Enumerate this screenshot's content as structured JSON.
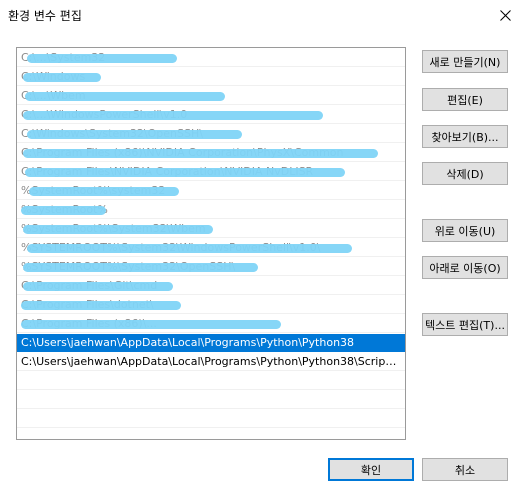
{
  "window": {
    "title": "환경 변수 편집"
  },
  "list": {
    "rows": [
      {
        "text": "C:\\...\\System32",
        "redacted": true
      },
      {
        "text": "C:\\Windows",
        "redacted": true
      },
      {
        "text": "C:\\...\\Wbem",
        "redacted": true
      },
      {
        "text": "C:\\...\\WindowsPowerShell\\v1.0",
        "redacted": true
      },
      {
        "text": "C:\\Windows\\System32\\OpenSSH\\",
        "redacted": true
      },
      {
        "text": "C:\\Program Files (x86)\\NVIDIA Corporation\\PhysX\\Common",
        "redacted": true
      },
      {
        "text": "C:\\Program Files\\NVIDIA Corporation\\NVIDIA NvDLISR",
        "redacted": true
      },
      {
        "text": "%SystemRoot%\\system32",
        "redacted": true
      },
      {
        "text": "%SystemRoot%",
        "redacted": true
      },
      {
        "text": "%SystemRoot%\\System32\\Wbem",
        "redacted": true
      },
      {
        "text": "%SYSTEMROOT%\\System32\\WindowsPowerShell\\v1.0\\",
        "redacted": true
      },
      {
        "text": "%SYSTEMROOT%\\System32\\OpenSSH\\",
        "redacted": true
      },
      {
        "text": "C:\\Program Files\\Git\\cmd",
        "redacted": true
      },
      {
        "text": "C:\\Program Files\\dotnet\\",
        "redacted": true
      },
      {
        "text": "C:\\Program Files (x86)\\...",
        "redacted": true
      },
      {
        "text": "C:\\Users\\jaehwan\\AppData\\Local\\Programs\\Python\\Python38",
        "redacted": false,
        "selected": true
      },
      {
        "text": "C:\\Users\\jaehwan\\AppData\\Local\\Programs\\Python\\Python38\\Scripts\\",
        "redacted": false,
        "selected": false
      }
    ]
  },
  "buttons": {
    "new": "새로 만들기(N)",
    "edit": "편집(E)",
    "browse": "찾아보기(B)...",
    "delete": "삭제(D)",
    "move_up": "위로 이동(U)",
    "move_down": "아래로 이동(O)",
    "edit_text": "텍스트 편집(T)...",
    "ok": "확인",
    "cancel": "취소"
  },
  "colors": {
    "selection": "#0078d7",
    "button_face": "#e1e1e1",
    "button_border": "#adadad",
    "redaction": "#7fd4f7"
  }
}
